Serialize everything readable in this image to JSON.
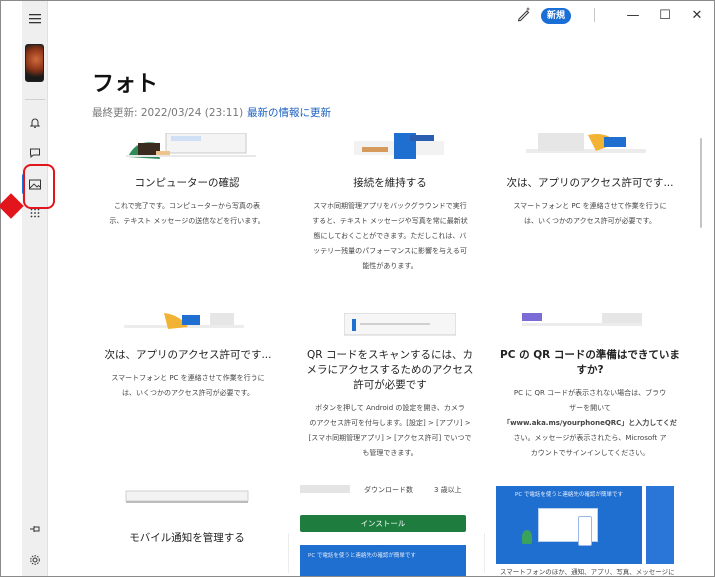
{
  "app": {
    "new_badge": "新規",
    "minimize": "—",
    "maximize": "☐",
    "close": "✕"
  },
  "header": {
    "title": "フォト",
    "last_update": "最終更新: 2022/03/24 (23:11)",
    "refresh": "最新の情報に更新"
  },
  "cards": {
    "c1": {
      "title": "コンピューターの確認",
      "body": [
        "これで完了です。コンピューターから写真の表",
        "示、テキスト メッセージの送信などを行います。"
      ]
    },
    "c2": {
      "title": "接続を維持する",
      "body": [
        "スマホ同期管理アプリをバックグラウンドで実行",
        "すると、テキスト メッセージや写真を常に最新状",
        "態にしておくことができます。ただしこれは、バ",
        "ッテリー残量のパフォーマンスに影響を与える可",
        "能性があります。"
      ]
    },
    "c3": {
      "title": "次は、アプリのアクセス許可です...",
      "body": [
        "スマートフォンと PC を連絡させて作業を行うに",
        "は、いくつかのアクセス許可が必要です。"
      ]
    },
    "c4": {
      "title": "次は、アプリのアクセス許可です...",
      "body": [
        "スマートフォンと PC を連絡させて作業を行うに",
        "は、いくつかのアクセス許可が必要です。"
      ]
    },
    "c5": {
      "title": [
        "QR コードをスキャンするには、カ",
        "メラにアクセスするためのアクセス",
        "許可が必要です"
      ],
      "body": [
        "ボタンを押して Android の設定を開き、カメラ",
        "のアクセス許可を付与します。[設定] > [アプリ] >",
        "[スマホ同期管理アプリ] > [アクセス許可] でいつで",
        "も管理できます。"
      ]
    },
    "c6": {
      "title": [
        "PC の QR コードの準備はできていま",
        "すか?"
      ],
      "body": [
        "PC に QR コードが表示されない場合は、ブラウ",
        "ザーを開いて",
        "「www.aka.ms/yourphoneQRC」と入力してくだ",
        "さい。メッセージが表示されたら、Microsoft ア",
        "カウントでサインインしてください。"
      ]
    },
    "c7": {
      "title": "モバイル通知を管理する"
    },
    "c8": {
      "install": "インストール",
      "downloads": "ダウンロード数",
      "rating": "3 歳以上"
    },
    "c9": {
      "panel_text": "PC で電話を使うと連絡先の確認が簡単です",
      "footer": "スマートフォンのほか、通知、アプリ、写真、メッセージに"
    }
  },
  "colors": {
    "accent": "#1a6fd6",
    "highlight": "#e2151c",
    "install": "#1e7d3e"
  }
}
